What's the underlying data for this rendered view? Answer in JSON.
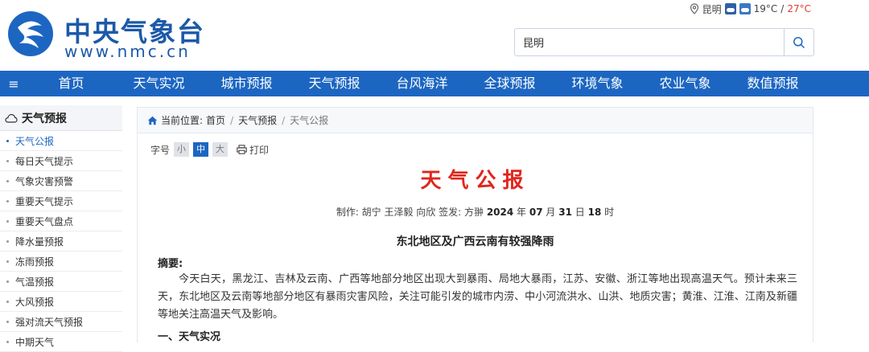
{
  "brand": {
    "title": "中央气象台",
    "url": "www.nmc.cn"
  },
  "topbar": {
    "city": "昆明",
    "temp_low": "19°C",
    "slash": "/",
    "temp_high": "27°C"
  },
  "search": {
    "value": "昆明"
  },
  "nav": {
    "menu_icon": "≡",
    "items": [
      "首页",
      "天气实况",
      "城市预报",
      "天气预报",
      "台风海洋",
      "全球预报",
      "环境气象",
      "农业气象",
      "数值预报"
    ]
  },
  "sidebar": {
    "title": "天气预报",
    "items": [
      "天气公报",
      "每日天气提示",
      "气象灾害预警",
      "重要天气提示",
      "重要天气盘点",
      "降水量预报",
      "冻雨预报",
      "气温预报",
      "大风预报",
      "强对流天气预报",
      "中期天气"
    ]
  },
  "breadcrumb": {
    "prefix": "当前位置:",
    "home": "首页",
    "section": "天气预报",
    "current": "天气公报"
  },
  "toolbar": {
    "label": "字号",
    "small": "小",
    "medium": "中",
    "large": "大",
    "print": "打印"
  },
  "doc": {
    "title": "天气公报",
    "meta_prefix": "制作: 胡宁 王泽毅 向欣  签发: 方翀",
    "year": "2024",
    "year_unit": "年",
    "month": "07",
    "month_unit": "月",
    "day": "31",
    "day_unit": "日",
    "hour": "18",
    "hour_unit": "时",
    "subtitle": "东北地区及广西云南有较强降雨",
    "abstract_label": "摘要:",
    "abstract": "今天白天，黑龙江、吉林及云南、广西等地部分地区出现大到暴雨、局地大暴雨，江苏、安徽、浙江等地出现高温天气。预计未来三天，东北地区及云南等地部分地区有暴雨灾害风险，关注可能引发的城市内涝、中小河流洪水、山洪、地质灾害；黄淮、江淮、江南及新疆等地关注高温天气及影响。",
    "section1": "一、天气实况"
  }
}
